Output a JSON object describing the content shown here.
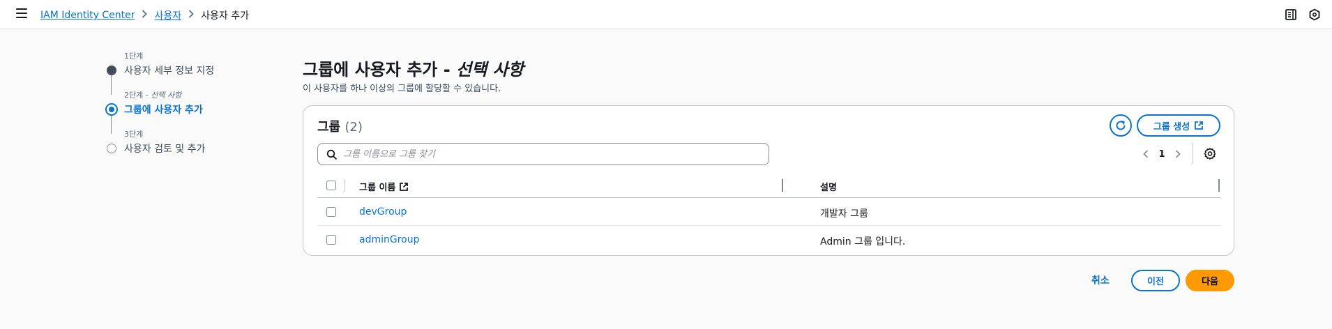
{
  "breadcrumb": {
    "items": [
      "IAM Identity Center",
      "사용자"
    ],
    "current": "사용자 추가"
  },
  "steps": [
    {
      "number": "1단계",
      "title": "사용자 세부 정보 지정",
      "state": "completed"
    },
    {
      "number": "2단계",
      "number_suffix": " - 선택 사항",
      "title": "그룹에 사용자 추가",
      "state": "active"
    },
    {
      "number": "3단계",
      "title": "사용자 검토 및 추가",
      "state": "pending"
    }
  ],
  "page": {
    "title": "그룹에 사용자 추가 - ",
    "title_optional": "선택 사항",
    "description": "이 사용자를 하나 이상의 그룹에 할당할 수 있습니다."
  },
  "groups_panel": {
    "title": "그룹",
    "count": "(2)",
    "create_label": "그룹 생성",
    "search_placeholder": "그룹 이름으로 그룹 찾기",
    "current_page": "1",
    "columns": [
      "그룹 이름",
      "설명"
    ],
    "rows": [
      {
        "name": "devGroup",
        "description": "개발자 그룹"
      },
      {
        "name": "adminGroup",
        "description": "Admin 그룹 입니다."
      }
    ]
  },
  "footer": {
    "cancel_label": "취소",
    "previous_label": "이전",
    "next_label": "다음"
  },
  "colors": {
    "link": "#0972d3",
    "primary_button": "#ff9900",
    "text": "#16191f"
  },
  "icons": [
    "menu-icon",
    "chevron-right-icon",
    "notes-icon",
    "feedback-icon",
    "refresh-icon",
    "external-link-icon",
    "search-icon",
    "chevron-left-icon",
    "settings-icon"
  ]
}
